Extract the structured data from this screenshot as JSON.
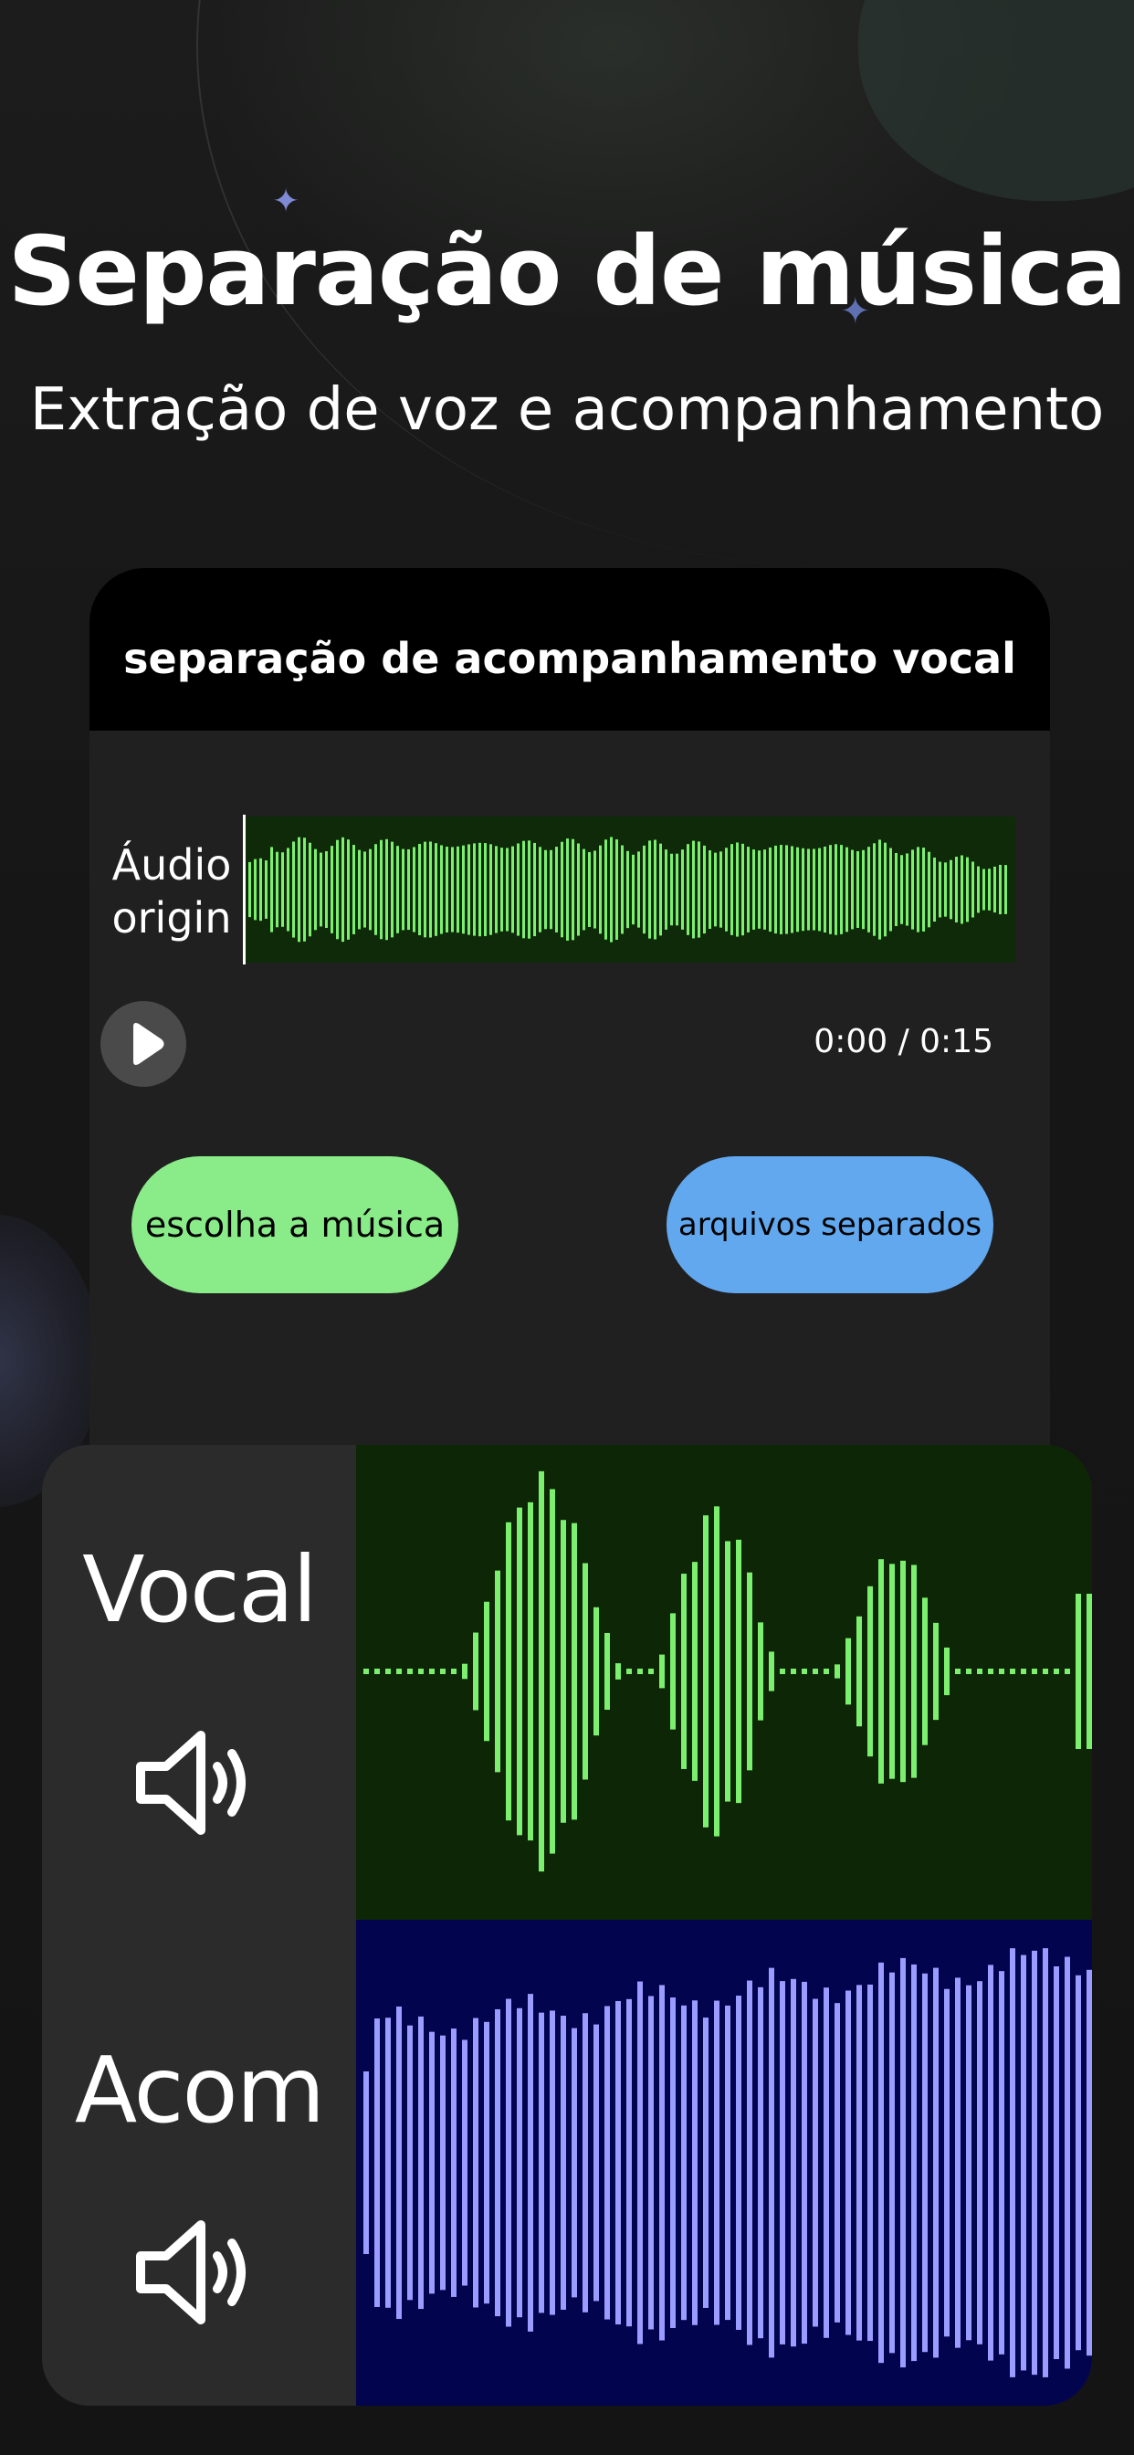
{
  "hero": {
    "title": "Separação de música",
    "subtitle": "Extração de voz e acompanhamento"
  },
  "card": {
    "header_title": "separação de acompanhamento vocal",
    "original_label": "Áudio origin",
    "time": "0:00 / 0:15",
    "choose_button": "escolha a música",
    "separated_button": "arquivos separados"
  },
  "tracks": {
    "vocal_label": "Vocal",
    "accomp_label": "Acom"
  },
  "colors": {
    "accent_green": "#8aec88",
    "accent_blue": "#62a8ef",
    "wave_green": "#7cf06e",
    "wave_purple": "#9b9cff",
    "green_bg": "#0d2605",
    "blue_bg": "#02044e"
  },
  "icons": {
    "play": "play-icon",
    "speaker": "speaker-volume-icon",
    "sparkle": "sparkle-icon"
  }
}
